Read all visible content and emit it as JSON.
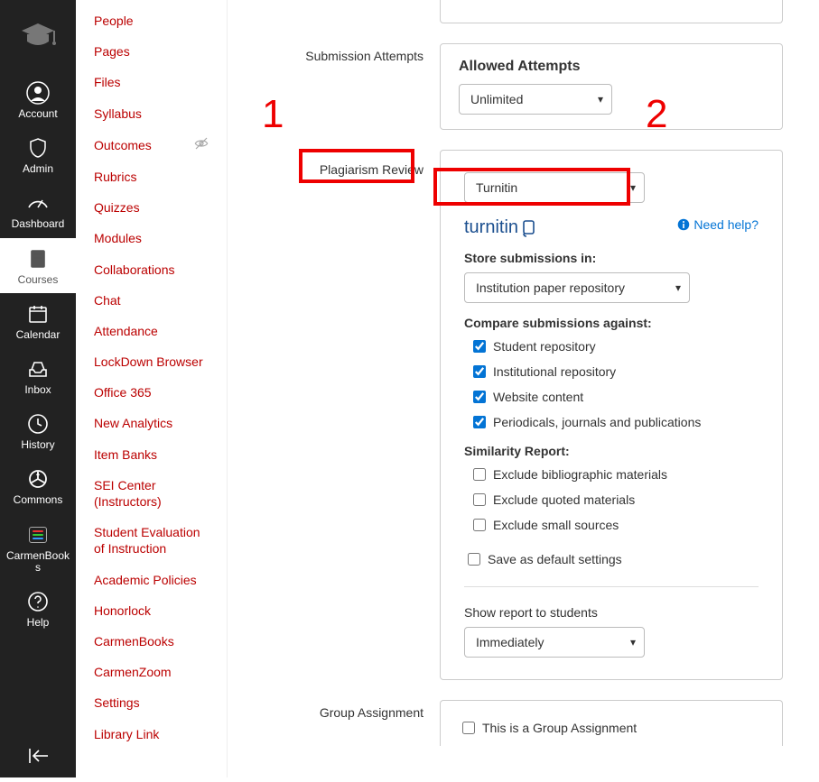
{
  "global_nav": {
    "account": "Account",
    "admin": "Admin",
    "dashboard": "Dashboard",
    "courses": "Courses",
    "calendar": "Calendar",
    "inbox": "Inbox",
    "history": "History",
    "commons": "Commons",
    "carmenbooks": "CarmenBooks",
    "help": "Help"
  },
  "course_nav": [
    "People",
    "Pages",
    "Files",
    "Syllabus",
    "Outcomes",
    "Rubrics",
    "Quizzes",
    "Modules",
    "Collaborations",
    "Chat",
    "Attendance",
    "LockDown Browser",
    "Office 365",
    "New Analytics",
    "Item Banks",
    "SEI Center (Instructors)",
    "Student Evaluation of Instruction",
    "Academic Policies",
    "Honorlock",
    "CarmenBooks",
    "CarmenZoom",
    "Settings",
    "Library Link"
  ],
  "form": {
    "submission_attempts": {
      "label": "Submission Attempts",
      "heading": "Allowed Attempts",
      "value": "Unlimited"
    },
    "plagiarism": {
      "label": "Plagiarism Review",
      "tool_value": "Turnitin",
      "brand": "turnitin",
      "need_help": "Need help?",
      "store_label": "Store submissions in:",
      "store_value": "Institution paper repository",
      "compare_label": "Compare submissions against:",
      "compare_opts": [
        "Student repository",
        "Institutional repository",
        "Website content",
        "Periodicals, journals and publications"
      ],
      "similarity_label": "Similarity Report:",
      "similarity_opts": [
        "Exclude bibliographic materials",
        "Exclude quoted materials",
        "Exclude small sources"
      ],
      "save_default": "Save as default settings",
      "show_report_label": "Show report to students",
      "show_report_value": "Immediately"
    },
    "group": {
      "label": "Group Assignment",
      "checkbox": "This is a Group Assignment"
    }
  },
  "annotations": {
    "one": "1",
    "two": "2"
  }
}
